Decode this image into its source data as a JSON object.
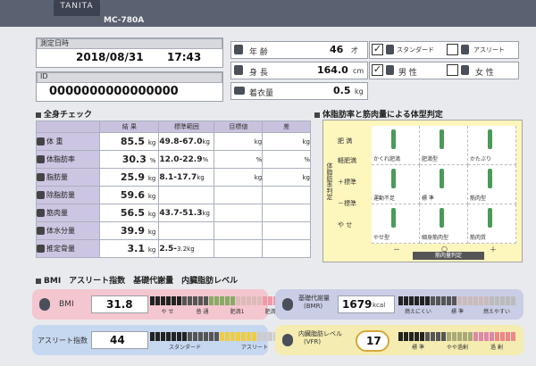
{
  "header": {
    "logo": "TANITA",
    "model": "MC-780A"
  },
  "measure": {
    "date_label": "測定日時",
    "date": "2018/08/31",
    "time": "17:43",
    "id_label": "ID",
    "id": "0000000000000000"
  },
  "profile": {
    "age_label": "年 齢",
    "age": "46",
    "age_unit": "才",
    "height_label": "身 長",
    "height": "164.0",
    "height_unit": "cm",
    "clothes_label": "着衣量",
    "clothes": "0.5",
    "clothes_unit": "kg",
    "body_type": {
      "standard": "スタンダード",
      "athlete": "アスリート",
      "standard_checked": "✓"
    },
    "sex": {
      "male": "男 性",
      "female": "女 性",
      "male_checked": "✓"
    }
  },
  "body_check": {
    "title": "全身チェック",
    "headers": {
      "result": "結 果",
      "range": "標準範囲",
      "target": "目標値",
      "diff": "差"
    },
    "rows": [
      {
        "label": "体 重",
        "value": "85.5",
        "unit": "kg",
        "range": "49.8-67.0",
        "range_unit": "kg",
        "target_unit": "kg",
        "diff_unit": "kg"
      },
      {
        "label": "体脂肪率",
        "value": "30.3",
        "unit": "%",
        "range": "12.0-22.9",
        "range_unit": "%",
        "target_unit": "%",
        "diff_unit": "%"
      },
      {
        "label": "脂肪量",
        "value": "25.9",
        "unit": "kg",
        "range": "8.1-17.7",
        "range_unit": "kg",
        "target_unit": "kg",
        "diff_unit": "kg"
      },
      {
        "label": "除脂肪量",
        "value": "59.6",
        "unit": "kg",
        "range": "",
        "range_unit": "",
        "target_unit": "",
        "diff_unit": ""
      },
      {
        "label": "筋肉量",
        "value": "56.5",
        "unit": "kg",
        "range": "43.7-51.3",
        "range_unit": "kg",
        "target_unit": "",
        "diff_unit": ""
      },
      {
        "label": "体水分量",
        "value": "39.9",
        "unit": "kg",
        "range": "",
        "range_unit": "",
        "target_unit": "",
        "diff_unit": ""
      },
      {
        "label": "推定骨量",
        "value": "3.1",
        "unit": "kg",
        "range": "2.5-",
        "range_unit": "3.2kg",
        "target_unit": "",
        "diff_unit": ""
      }
    ]
  },
  "body_type_chart": {
    "title": "体脂肪率と筋肉量による体型判定",
    "y_axis": "体脂肪率判定",
    "y_levels": [
      "肥 満",
      "軽肥満",
      "＋標準",
      "－標準",
      "や せ"
    ],
    "cells": [
      [
        "かくれ肥満",
        "肥満型",
        "かたぶり"
      ],
      [
        "運動不足",
        "標 準",
        "筋肉型"
      ],
      [
        "やせ型",
        "細身筋肉型",
        "筋肉質"
      ]
    ],
    "x_ticks": [
      "－",
      "○",
      "＋"
    ],
    "x_axis": "筋肉量判定"
  },
  "scores": {
    "title": "BMI　アスリート指数　基礎代謝量　内臓脂肪レベル",
    "bmi": {
      "label": "BMI",
      "value": "31.8",
      "levels": [
        "や せ",
        "普 通",
        "肥満1",
        "肥満2"
      ]
    },
    "athlete": {
      "label": "アスリート指数",
      "value": "44",
      "levels": [
        "スタンダード",
        "アスリート"
      ]
    },
    "bmr": {
      "label": "基礎代謝量",
      "label2": "(BMR)",
      "value": "1679",
      "unit": "kcal",
      "levels": [
        "燃えにくい",
        "標 準",
        "燃えやすい"
      ]
    },
    "vfr": {
      "label": "内臓脂肪レベル",
      "label2": "(VFR)",
      "value": "17",
      "levels": [
        "標 準",
        "やや過剰",
        "過 剰"
      ],
      "ticks": [
        "5",
        "10",
        "15"
      ]
    }
  },
  "colors": {
    "purple": "#cdc6e2",
    "yellow_panel": "#fdf6bd",
    "bmi": "#f4c6cf",
    "athlete": "#c6d7f0",
    "bmr": "#c9cde6",
    "vfr": "#f4ecb0"
  }
}
